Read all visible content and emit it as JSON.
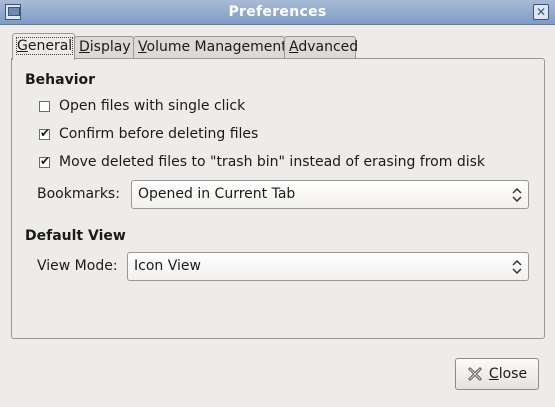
{
  "window": {
    "title": "Preferences",
    "close_icon": "close-icon",
    "app_icon": "window-icon"
  },
  "tabs": [
    {
      "label": "General",
      "mnemonic": "G",
      "rest": "eneral",
      "active": true
    },
    {
      "label": "Display",
      "mnemonic": "D",
      "rest": "isplay",
      "active": false
    },
    {
      "label": "Volume Management",
      "mnemonic": "V",
      "rest": "olume Management",
      "active": false
    },
    {
      "label": "Advanced",
      "mnemonic": "A",
      "rest": "dvanced",
      "active": false
    }
  ],
  "behavior": {
    "title": "Behavior",
    "options": [
      {
        "label": "Open files with single click",
        "checked": false
      },
      {
        "label": "Confirm before deleting files",
        "checked": true
      },
      {
        "label": "Move deleted files to \"trash bin\" instead of erasing from disk",
        "checked": true
      }
    ],
    "bookmarks_label": "Bookmarks:",
    "bookmarks_value": "Opened in Current Tab"
  },
  "default_view": {
    "title": "Default View",
    "view_mode_label": "View Mode:",
    "view_mode_value": "Icon View"
  },
  "buttons": {
    "close_mnemonic": "C",
    "close_rest": "lose",
    "close_label": "Close"
  },
  "colors": {
    "titlebar": "#8fa7cb",
    "background": "#edeceb"
  }
}
